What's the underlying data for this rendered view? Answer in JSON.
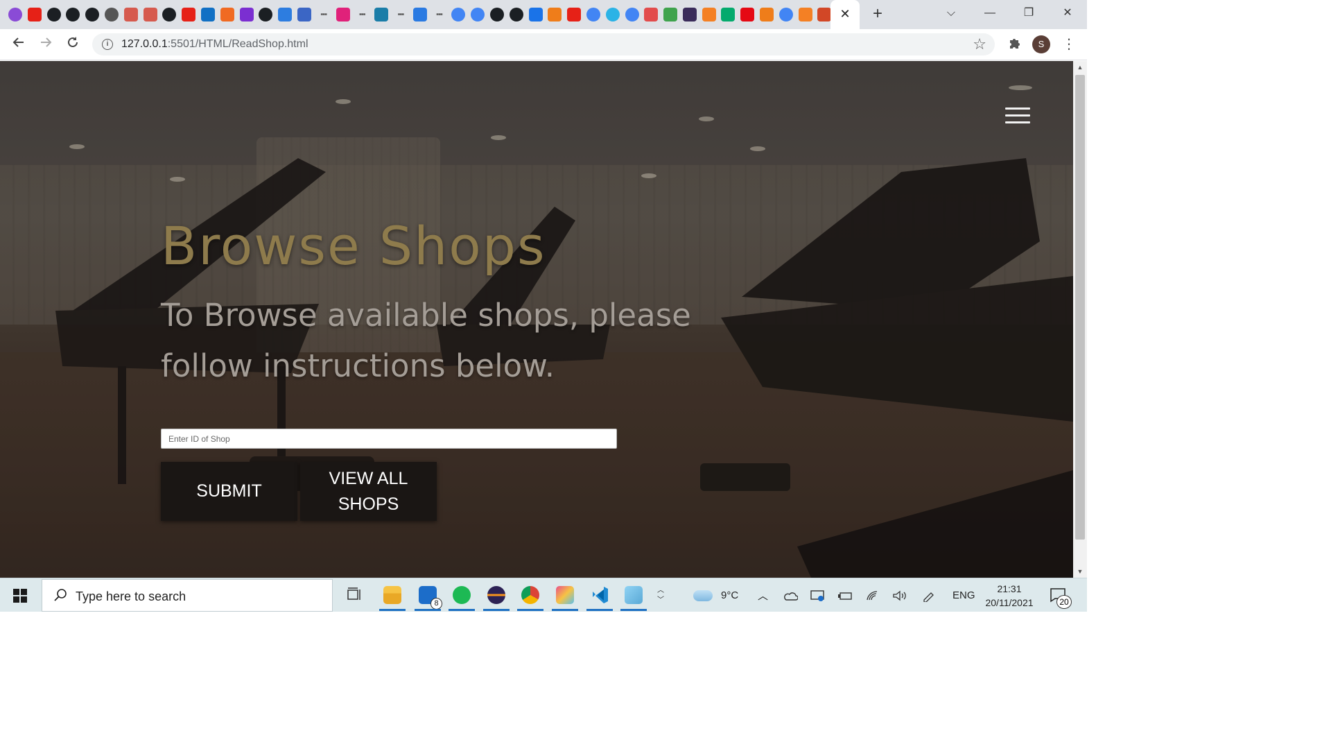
{
  "browser": {
    "tabs": [
      {
        "icon": "purple-circle-icon",
        "color": "#8a4bd6"
      },
      {
        "icon": "youtube-icon",
        "color": "#e62117"
      },
      {
        "icon": "github-icon",
        "color": "#1b1f23"
      },
      {
        "icon": "github-icon",
        "color": "#1b1f23"
      },
      {
        "icon": "github-icon",
        "color": "#1b1f23"
      },
      {
        "icon": "globe-icon",
        "color": "#555555"
      },
      {
        "icon": "openai-icon",
        "color": "#d65a4e"
      },
      {
        "icon": "openai-icon",
        "color": "#d65a4e"
      },
      {
        "icon": "github-icon",
        "color": "#1b1f23"
      },
      {
        "icon": "youtube-icon",
        "color": "#e62117"
      },
      {
        "icon": "onenote-icon",
        "color": "#1170c4"
      },
      {
        "icon": "g-orange-icon",
        "color": "#f06a22"
      },
      {
        "icon": "bootstrap-icon",
        "color": "#7b2fd1"
      },
      {
        "icon": "github-icon",
        "color": "#1b1f23"
      },
      {
        "icon": "gear-blue-icon",
        "color": "#2d7de0"
      },
      {
        "icon": "mdn-icon",
        "color": "#3b66c5"
      },
      {
        "icon": "dots-icon",
        "color": "#666666"
      },
      {
        "icon": "square-pink-icon",
        "color": "#e0217a"
      },
      {
        "icon": "dots-icon",
        "color": "#666666"
      },
      {
        "icon": "edge-blue-icon",
        "color": "#1a7da8"
      },
      {
        "icon": "dots-icon",
        "color": "#666666"
      },
      {
        "icon": "bing-icon",
        "color": "#2a7ae2"
      },
      {
        "icon": "dots-icon",
        "color": "#666666"
      },
      {
        "icon": "google-icon",
        "color": "#4285f4"
      },
      {
        "icon": "google-icon",
        "color": "#4285f4"
      },
      {
        "icon": "github-icon",
        "color": "#1b1f23"
      },
      {
        "icon": "github-icon",
        "color": "#1b1f23"
      },
      {
        "icon": "diamond-blue-icon",
        "color": "#1a73e8"
      },
      {
        "icon": "tree-orange-icon",
        "color": "#ef7d1a"
      },
      {
        "icon": "youtube-icon",
        "color": "#e62117"
      },
      {
        "icon": "google-icon",
        "color": "#4285f4"
      },
      {
        "icon": "c-circle-icon",
        "color": "#2bb3e6"
      },
      {
        "icon": "google-icon",
        "color": "#4285f4"
      },
      {
        "icon": "code-brackets-icon",
        "color": "#e24c4c"
      },
      {
        "icon": "colorful-blocks-icon",
        "color": "#3fa34d"
      },
      {
        "icon": "b-dark-icon",
        "color": "#3a2c5a"
      },
      {
        "icon": "stackoverflow-icon",
        "color": "#f48024"
      },
      {
        "icon": "w3schools-icon",
        "color": "#04aa6d"
      },
      {
        "icon": "netflix-icon",
        "color": "#e50914"
      },
      {
        "icon": "tree-orange-icon",
        "color": "#ef7d1a"
      },
      {
        "icon": "google-icon",
        "color": "#4285f4"
      },
      {
        "icon": "stackoverflow-icon",
        "color": "#f48024"
      },
      {
        "icon": "powerpoint-icon",
        "color": "#d24726"
      }
    ],
    "tab_close": "✕",
    "new_tab": "+",
    "controls": {
      "dropdown": "⌵",
      "minimize": "—",
      "restore": "❐",
      "close": "✕"
    },
    "url_host": "127.0.0.1",
    "url_path": ":5501/HTML/ReadShop.html",
    "profile_initial": "S"
  },
  "page": {
    "title": "Browse Shops",
    "subtitle": "To Browse available shops, please follow instructions below.",
    "shop_id_placeholder": "Enter ID of Shop",
    "submit_label": "SUBMIT",
    "view_all_label": "VIEW ALL SHOPS",
    "title_color": "#8e7b4c"
  },
  "taskbar": {
    "search_placeholder": "Type here to search",
    "mail_badge": "8",
    "weather": "9°C",
    "language": "ENG",
    "time": "21:31",
    "date": "20/11/2021",
    "notification_count": "20"
  }
}
